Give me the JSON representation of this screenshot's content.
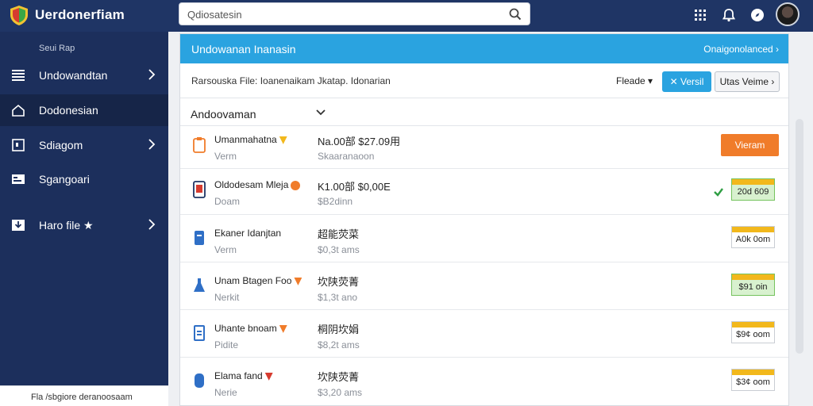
{
  "app": {
    "title": "Uerdonerfiam"
  },
  "search": {
    "placeholder": "Qdiosatesin"
  },
  "sidebar": {
    "section": "Seui Rap",
    "items": [
      {
        "label": "Undowandtan",
        "icon": "list-icon",
        "chevron": true
      },
      {
        "label": "Dodonesian",
        "icon": "home-icon",
        "chevron": false,
        "active": true
      },
      {
        "label": "Sdiagom",
        "icon": "box-icon",
        "chevron": true
      },
      {
        "label": "Sgangoari",
        "icon": "card-icon",
        "chevron": false
      },
      {
        "label": "Haro file ★",
        "icon": "download-icon",
        "chevron": true
      }
    ],
    "footer": "Fla /sbgiore deranoosaam"
  },
  "panel": {
    "title": "Undowanan Inanasin",
    "link": "Onaigonolanced ›",
    "file_label": "Rarsouska File: Ioanenaikam Jkatap. Idonarian",
    "filter": "Fleade ▾",
    "btn_primary": "✕ Versil",
    "btn_secondary": "Utas Veime ›",
    "group": "Andoovaman"
  },
  "rows": [
    {
      "name": "Umanmahatna",
      "sub": "Verm",
      "price": "Na.00部 $27.09用",
      "meta": "Skaaranaoon",
      "action": "button",
      "action_label": "Vieram"
    },
    {
      "name": "Oldodesam Mleja",
      "sub": "Doam",
      "price": "K1.00部 $0,00E",
      "meta": "$B2dinn",
      "action": "badge",
      "badge_value": "20d 609",
      "badge_style": "green",
      "check": true
    },
    {
      "name": "Ekaner Idanjtan",
      "sub": "Verm",
      "price": "超能荧菜",
      "meta": "$0,3t ams",
      "action": "badge",
      "badge_value": "A0k 0om",
      "badge_style": "plain"
    },
    {
      "name": "Unam Btagen Foo",
      "sub": "Nerkit",
      "price": "坎陕荧菁",
      "meta": "$1,3t ano",
      "action": "badge",
      "badge_value": "$91 oin",
      "badge_style": "green"
    },
    {
      "name": "Uhante bnoam",
      "sub": "Pidite",
      "price": "桐阴坎娟",
      "meta": "$8,2t ams",
      "action": "badge",
      "badge_value": "$9¢ oom",
      "badge_style": "plain"
    },
    {
      "name": "Elama fand",
      "sub": "Nerie",
      "price": "坎陕荧菁",
      "meta": "$3,20 ams",
      "action": "badge",
      "badge_value": "$3¢ oom",
      "badge_style": "plain"
    }
  ],
  "colors": {
    "topbar": "#1f3565",
    "sidebar": "#1c2f5c",
    "accent": "#2aa3e0",
    "orange": "#f07c2a",
    "badge_strip": "#f2b81c"
  }
}
